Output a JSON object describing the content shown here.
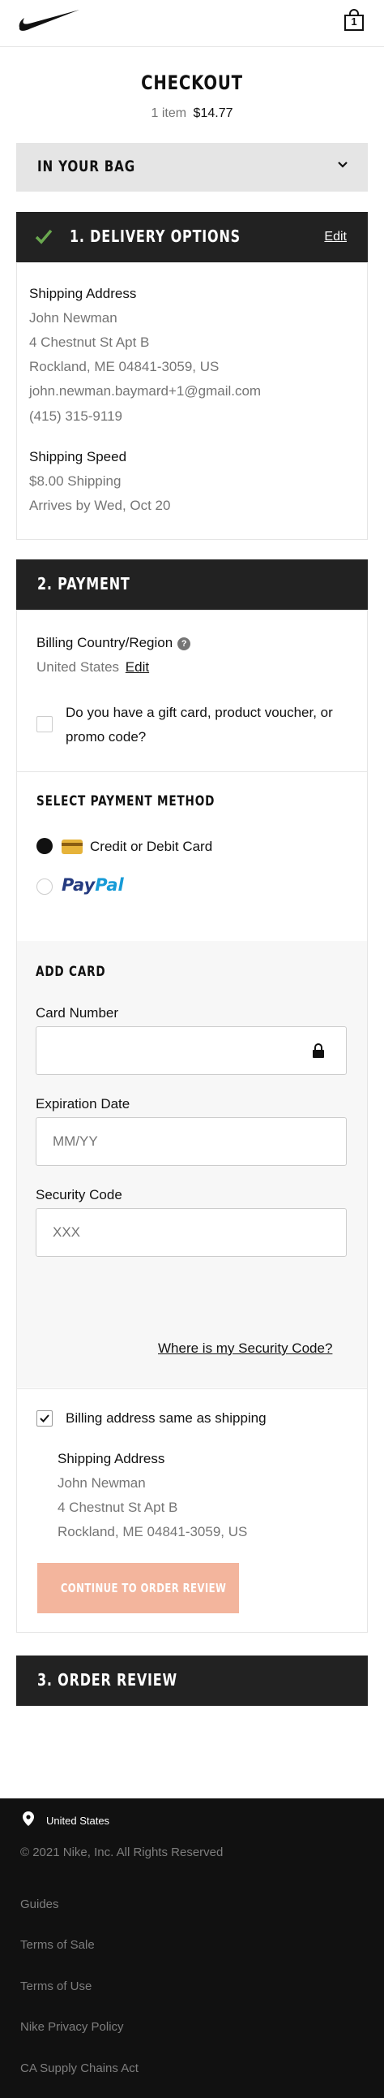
{
  "header": {
    "logo": "nike-swoosh",
    "bag_count": "1"
  },
  "checkout": {
    "title": "CHECKOUT",
    "items": "1 item",
    "total": "$14.77"
  },
  "bag": {
    "title": "IN YOUR BAG"
  },
  "delivery": {
    "title": "1. DELIVERY OPTIONS",
    "edit": "Edit",
    "shipping_address_label": "Shipping Address",
    "name": "John Newman",
    "street": "4 Chestnut St Apt B",
    "city": "Rockland, ME 04841-3059, US",
    "email": "john.newman.baymard+1@gmail.com",
    "phone": "(415) 315-9119",
    "shipping_speed_label": "Shipping Speed",
    "shipping_price": "$8.00 Shipping",
    "arrival": "Arrives by Wed, Oct 20"
  },
  "payment": {
    "title": "2. PAYMENT",
    "billing_country_label": "Billing Country/Region",
    "help_icon": "?",
    "billing_country": "United States",
    "billing_edit": "Edit",
    "gift_line1": "Do you have a gift card, product voucher, or",
    "gift_line2": "promo code?",
    "select_method_title": "SELECT PAYMENT METHOD",
    "methods": {
      "card_label": "Credit or Debit Card",
      "paypal_pay": "Pay",
      "paypal_pal": "Pal"
    },
    "add_card": {
      "title": "ADD CARD",
      "card_number_label": "Card Number",
      "card_number_value": "",
      "expiration_label": "Expiration Date",
      "expiration_placeholder": "MM/YY",
      "security_label": "Security Code",
      "security_placeholder": "XXX",
      "security_help": "Where is my Security Code?"
    },
    "billing_same": {
      "label": "Billing address same as shipping",
      "address_label": "Shipping Address",
      "name": "John Newman",
      "street": "4 Chestnut St Apt B",
      "city": "Rockland, ME 04841-3059, US"
    },
    "continue_button": "CONTINUE TO ORDER REVIEW"
  },
  "review": {
    "title": "3. ORDER REVIEW"
  },
  "footer": {
    "country": "United States",
    "copyright": "© 2021 Nike, Inc. All Rights Reserved",
    "links": [
      "Guides",
      "Terms of Sale",
      "Terms of Use",
      "Nike Privacy Policy",
      "CA Supply Chains Act"
    ]
  },
  "colors": {
    "accent_green": "#6aa84f",
    "cta_disabled": "#f3b59d",
    "dark_bar": "#222222",
    "footer_bg": "#111111"
  }
}
